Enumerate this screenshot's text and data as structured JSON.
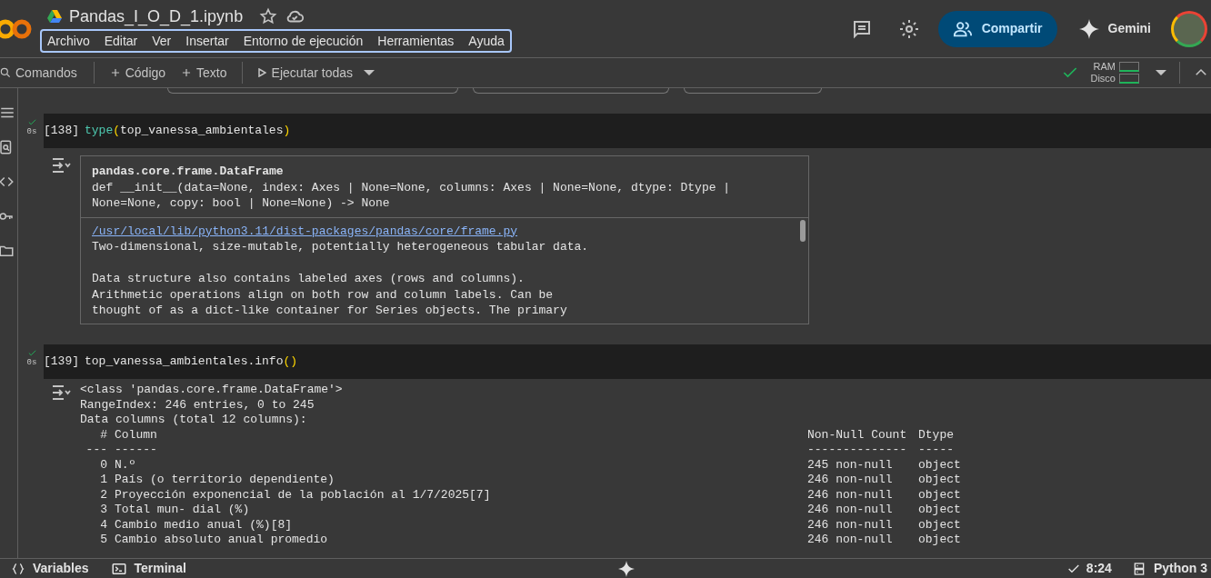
{
  "header": {
    "file_name": "Pandas_I_O_D_1.ipynb",
    "starred": false,
    "menu": [
      "Archivo",
      "Editar",
      "Ver",
      "Insertar",
      "Entorno de ejecución",
      "Herramientas",
      "Ayuda"
    ],
    "share_label": "Compartir",
    "gemini_label": "Gemini"
  },
  "toolbar": {
    "commands": "Comandos",
    "add_code": "Código",
    "add_text": "Texto",
    "run_all": "Ejecutar todas",
    "ram_label": "RAM",
    "disk_label": "Disco"
  },
  "cells": [
    {
      "kind": "tooltip",
      "exec_count": "[138]",
      "time": "0s",
      "code": [
        {
          "kind": "function",
          "s": "type"
        },
        {
          "kind": "bracket",
          "s": "("
        },
        {
          "kind": "name",
          "s": "top_vanessa_ambientales"
        },
        {
          "kind": "bracket",
          "s": ")"
        }
      ],
      "output": {
        "title": "pandas.core.frame.DataFrame",
        "signature": "def __init__(data=None, index: Axes | None=None, columns: Axes | None=None, dtype: Dtype | None=None, copy: bool | None=None) -> None",
        "link": "/usr/local/lib/python3.11/dist-packages/pandas/core/frame.py",
        "doc_paragraphs": [
          [
            "Two-dimensional, size-mutable, potentially heterogeneous tabular data."
          ],
          [
            "Data structure also contains labeled axes (rows and columns).",
            "Arithmetic operations align on both row and column labels. Can be",
            "thought of as a dict-like container for Series objects. The primary"
          ]
        ]
      }
    },
    {
      "kind": "info",
      "exec_count": "[139]",
      "time": "0s",
      "code": [
        {
          "kind": "name",
          "s": "top_vanessa_ambientales.info"
        },
        {
          "kind": "bracket",
          "s": "()"
        }
      ],
      "output": {
        "lines": [
          "<class 'pandas.core.frame.DataFrame'>",
          "RangeIndex: 246 entries, 0 to 245",
          "Data columns (total 12 columns):"
        ],
        "header": {
          "num": "#",
          "column": "Column",
          "count": "Non-Null Count",
          "dtype": "Dtype"
        },
        "rule": {
          "num": "---",
          "column": "------",
          "count": "--------------",
          "dtype": "-----"
        },
        "rows": [
          {
            "num": "0",
            "column": "N.º",
            "count": "245 non-null",
            "dtype": "object"
          },
          {
            "num": "1",
            "column": "País (o territorio dependiente)",
            "count": "246 non-null",
            "dtype": "object"
          },
          {
            "num": "2",
            "column": "Proyección exponencial de la población al 1/7/2025[7]",
            "count": "246 non-null",
            "dtype": "object"
          },
          {
            "num": "3",
            "column": "Total mun- dial (%)",
            "count": "246 non-null",
            "dtype": "object"
          },
          {
            "num": "4",
            "column": "Cambio medio anual (%)[8]",
            "count": "246 non-null",
            "dtype": "object"
          },
          {
            "num": "5",
            "column": "Cambio absoluto anual promedio",
            "count": "246 non-null",
            "dtype": "object"
          }
        ]
      }
    }
  ],
  "status_bar": {
    "variables": "Variables",
    "terminal": "Terminal",
    "time": "8:24",
    "runtime": "Python 3"
  }
}
